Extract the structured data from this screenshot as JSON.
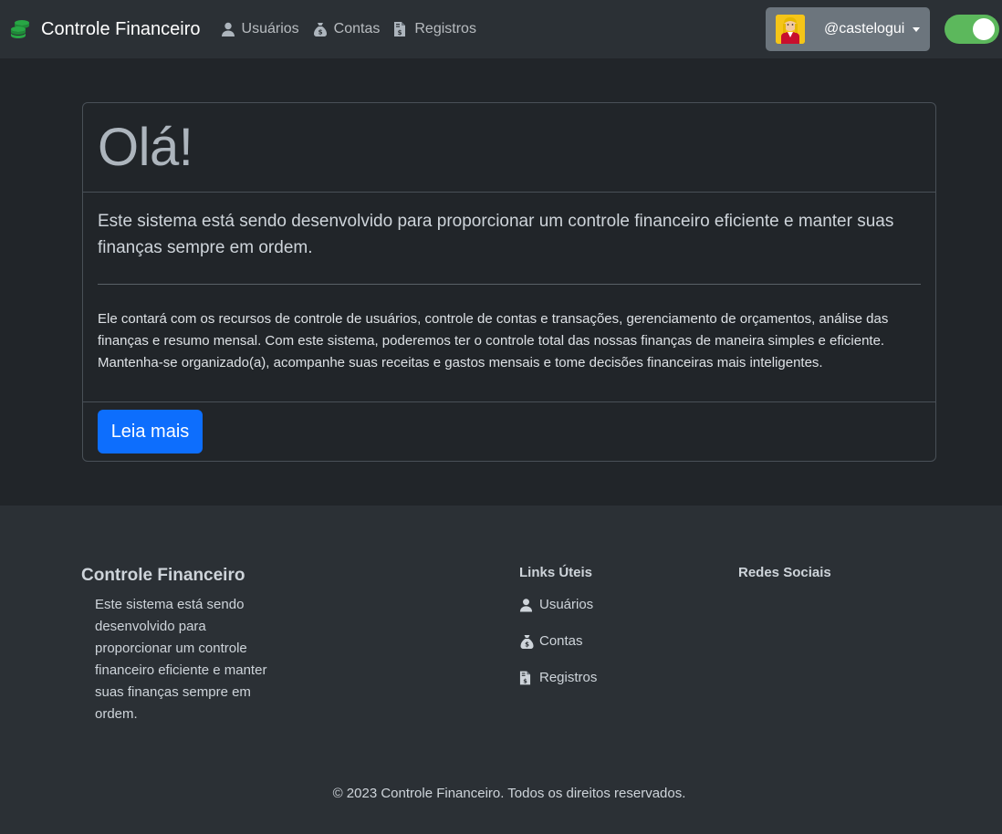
{
  "navbar": {
    "brand": "Controle Financeiro",
    "brand_icon": "coins-stack-icon",
    "links": [
      {
        "label": "Usuários",
        "icon": "user-icon"
      },
      {
        "label": "Contas",
        "icon": "money-bag-icon"
      },
      {
        "label": "Registros",
        "icon": "file-invoice-dollar-icon"
      }
    ],
    "user": {
      "handle": "@castelogui",
      "avatar": "avatar-icon"
    },
    "theme_toggle": {
      "on": true,
      "color": "#5cb85c"
    }
  },
  "card": {
    "heading": "Olá!",
    "lead": "Este sistema está sendo desenvolvido para proporcionar um controle financeiro eficiente e manter suas finanças sempre em ordem.",
    "description": "Ele contará com os recursos de controle de usuários, controle de contas e transações, gerenciamento de orçamentos, análise das finanças e resumo mensal. Com este sistema, poderemos ter o controle total das nossas finanças de maneira simples e eficiente. Mantenha-se organizado(a), acompanhe suas receitas e gastos mensais e tome decisões financeiras mais inteligentes.",
    "button": "Leia mais"
  },
  "footer": {
    "title": "Controle Financeiro",
    "about": "Este sistema está sendo desenvolvido para proporcionar um controle financeiro eficiente e manter suas finanças sempre em ordem.",
    "links_title": "Links Úteis",
    "links": [
      {
        "label": "Usuários",
        "icon": "user-icon"
      },
      {
        "label": "Contas",
        "icon": "money-bag-icon"
      },
      {
        "label": "Registros",
        "icon": "file-invoice-dollar-icon"
      }
    ],
    "social_title": "Redes Sociais",
    "copyright": "© 2023 Controle Financeiro. Todos os direitos reservados."
  },
  "colors": {
    "background": "#212529",
    "navbar": "#2b3035",
    "primary": "#0d6efd",
    "brand_icon": "#28a745"
  }
}
